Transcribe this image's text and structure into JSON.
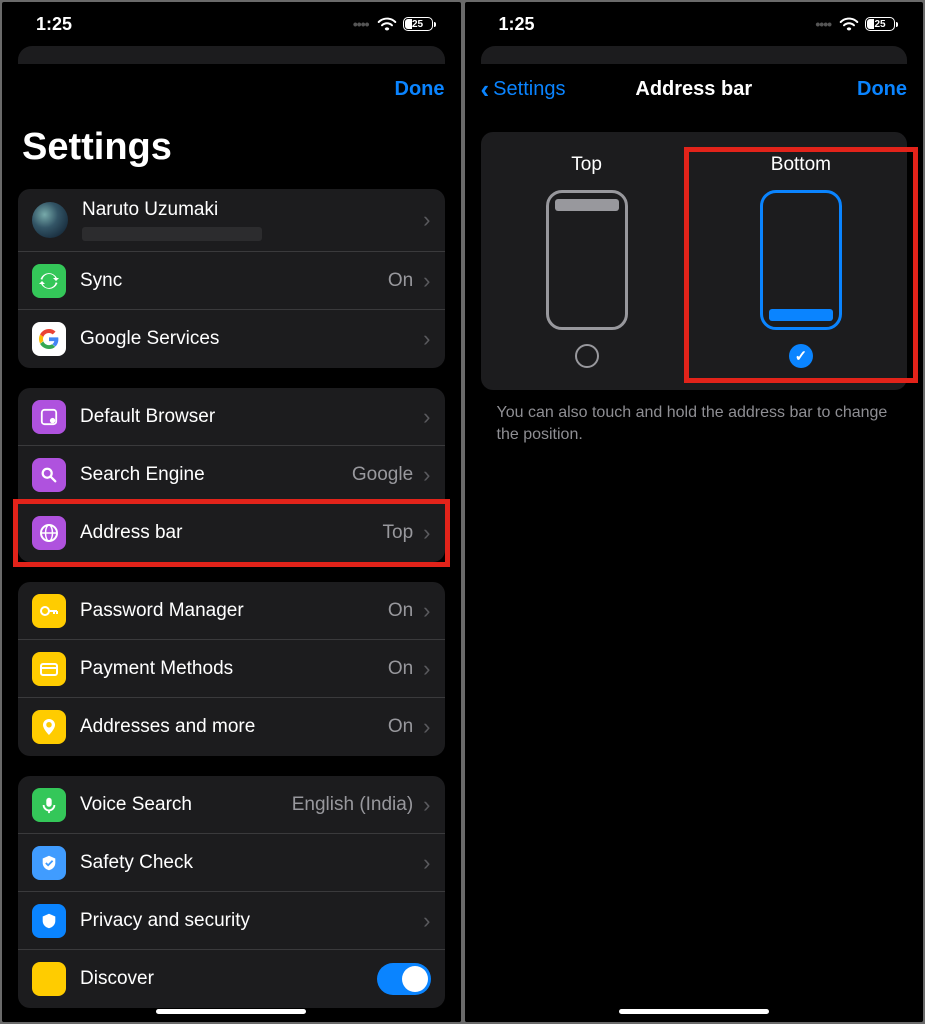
{
  "status": {
    "time": "1:25",
    "battery": "25"
  },
  "left": {
    "done": "Done",
    "title": "Settings",
    "profile": {
      "name": "Naruto Uzumaki"
    },
    "rows": {
      "sync": {
        "label": "Sync",
        "value": "On"
      },
      "google_services": {
        "label": "Google Services"
      },
      "default_browser": {
        "label": "Default Browser"
      },
      "search_engine": {
        "label": "Search Engine",
        "value": "Google"
      },
      "address_bar": {
        "label": "Address bar",
        "value": "Top"
      },
      "password_manager": {
        "label": "Password Manager",
        "value": "On"
      },
      "payment_methods": {
        "label": "Payment Methods",
        "value": "On"
      },
      "addresses": {
        "label": "Addresses and more",
        "value": "On"
      },
      "voice_search": {
        "label": "Voice Search",
        "value": "English (India)"
      },
      "safety_check": {
        "label": "Safety Check"
      },
      "privacy": {
        "label": "Privacy and security"
      },
      "discover": {
        "label": "Discover"
      }
    }
  },
  "right": {
    "back": "Settings",
    "title": "Address bar",
    "done": "Done",
    "options": {
      "top": "Top",
      "bottom": "Bottom"
    },
    "note": "You can also touch and hold the address bar to change the position."
  }
}
